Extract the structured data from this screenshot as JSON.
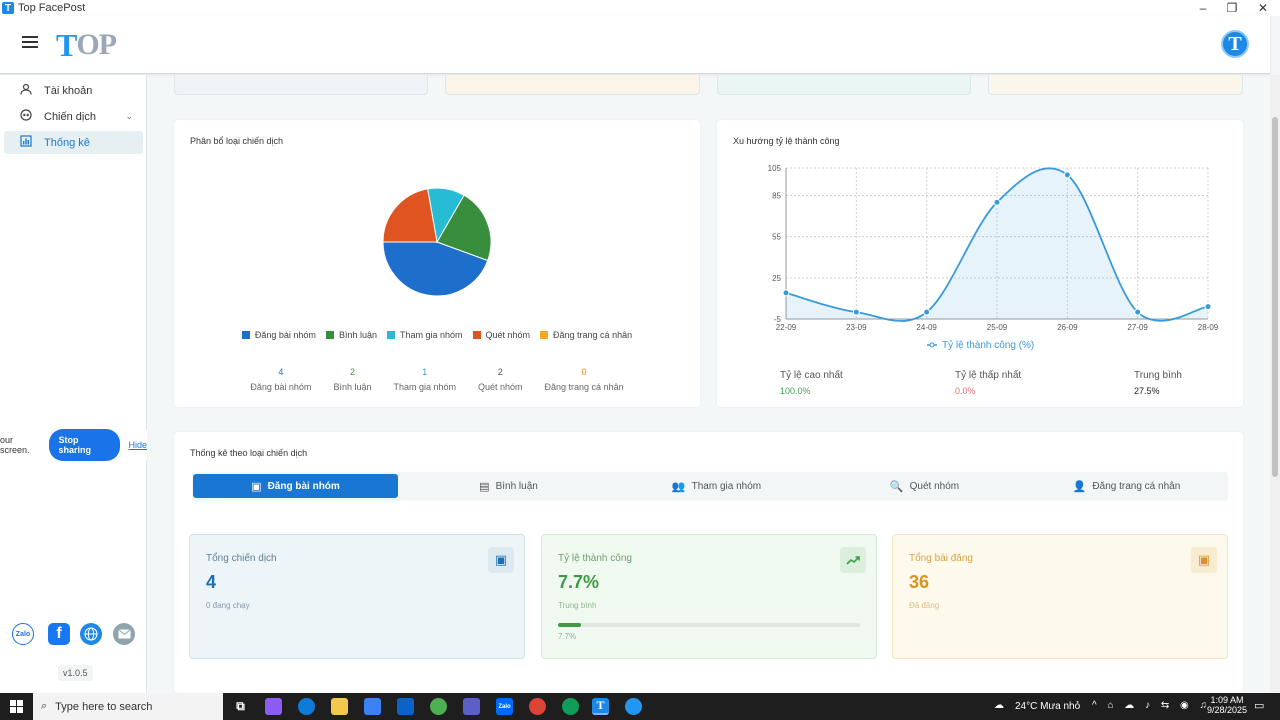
{
  "window": {
    "title": "Top FacePost"
  },
  "header": {
    "logo_t": "T",
    "logo_rest": "OP",
    "avatar_letter": "T"
  },
  "sidebar": {
    "items": [
      {
        "label": "Tài khoản",
        "icon": "user-icon"
      },
      {
        "label": "Chiến dịch",
        "icon": "campaign-icon"
      },
      {
        "label": "Thống kê",
        "icon": "chart-icon"
      }
    ],
    "share": {
      "text": "our screen.",
      "stop": "Stop sharing",
      "hide": "Hide"
    },
    "social": [
      "Zalo",
      "f"
    ],
    "version": "v1.0.5"
  },
  "distribution": {
    "title": "Phân bổ loại chiến dịch",
    "counts": [
      {
        "num": "4",
        "label": "Đăng bài nhóm"
      },
      {
        "num": "2",
        "label": "Bình luận"
      },
      {
        "num": "1",
        "label": "Tham gia nhóm"
      },
      {
        "num": "2",
        "label": "Quét nhóm"
      },
      {
        "num": "0",
        "label": "Đăng trang cá nhân"
      }
    ]
  },
  "trend": {
    "title": "Xu hướng tỷ lệ thành công",
    "stats": {
      "max_label": "Tỷ lệ cao nhất",
      "max_value": "100.0%",
      "min_label": "Tỷ lệ thấp nhất",
      "min_value": "0.0%",
      "avg_label": "Trung bình",
      "avg_value": "27.5%"
    }
  },
  "chart_data": [
    {
      "type": "pie",
      "title": "Phân bổ loại chiến dịch",
      "categories": [
        "Đăng bài nhóm",
        "Bình luận",
        "Tham gia nhóm",
        "Quét nhóm",
        "Đăng trang cá nhân"
      ],
      "values": [
        4,
        2,
        1,
        2,
        0
      ],
      "colors": [
        "#1e6fcc",
        "#388e3c",
        "#26bcd4",
        "#e05421",
        "#f5a623"
      ],
      "legend": "bottom"
    },
    {
      "type": "line",
      "title": "Xu hướng tỷ lệ thành công",
      "x": [
        "22-09",
        "23-09",
        "24-09",
        "25-09",
        "26-09",
        "27-09",
        "28-09"
      ],
      "series": [
        {
          "name": "Tỷ lệ thành công (%)",
          "values": [
            14,
            0,
            0,
            80,
            100,
            0,
            4
          ]
        }
      ],
      "yticks": [
        -5,
        25,
        55,
        85,
        105
      ],
      "ylim": [
        -5,
        105
      ],
      "grid": true,
      "legend": "bottom",
      "color": "#3a9ad9"
    }
  ],
  "by_type": {
    "title": "Thống kê theo loại chiến dịch",
    "tabs": [
      "Đăng bài nhóm",
      "Bình luận",
      "Tham gia nhóm",
      "Quét nhóm",
      "Đăng trang cá nhân"
    ],
    "cards": [
      {
        "title": "Tổng chiến dịch",
        "value": "4",
        "sub": "0 đang chạy"
      },
      {
        "title": "Tỷ lệ thành công",
        "value": "7.7%",
        "sub": "Trung bình",
        "progress": 7.7,
        "progress_label": "7.7%"
      },
      {
        "title": "Tổng bài đăng",
        "value": "36",
        "sub": "Đã đăng"
      }
    ]
  },
  "taskbar": {
    "search_placeholder": "Type here to search",
    "weather": "24°C  Mưa nhỏ",
    "time": "1:09 AM",
    "date": "9/28/2025"
  }
}
